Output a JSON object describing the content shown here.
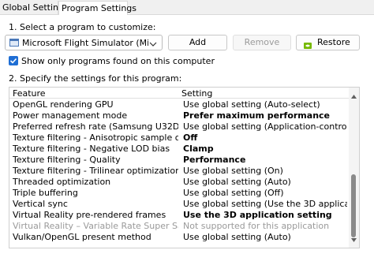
{
  "tabs": [
    {
      "label": "Global Settings"
    },
    {
      "label": "Program Settings"
    }
  ],
  "step1_label": "1. Select a program to customize:",
  "program_select": {
    "value": "Microsoft Flight Simulator (Micros..."
  },
  "buttons": {
    "add": "Add",
    "remove": "Remove",
    "restore": "Restore"
  },
  "show_only_checkbox": {
    "label": "Show only programs found on this computer",
    "checked": true
  },
  "step2_label": "2. Specify the settings for this program:",
  "table": {
    "headers": {
      "feature": "Feature",
      "setting": "Setting"
    },
    "rows": [
      {
        "feature": "OpenGL rendering GPU",
        "setting": "Use global setting (Auto-select)"
      },
      {
        "feature": "Power management mode",
        "setting": "Prefer maximum performance"
      },
      {
        "feature": "Preferred refresh rate (Samsung U32D970)",
        "setting": "Use global setting (Application-controlled)"
      },
      {
        "feature": "Texture filtering - Anisotropic sample opti...",
        "setting": "Off"
      },
      {
        "feature": "Texture filtering - Negative LOD bias",
        "setting": "Clamp"
      },
      {
        "feature": "Texture filtering - Quality",
        "setting": "Performance"
      },
      {
        "feature": "Texture filtering - Trilinear optimization",
        "setting": "Use global setting (On)"
      },
      {
        "feature": "Threaded optimization",
        "setting": "Use global setting (Auto)"
      },
      {
        "feature": "Triple buffering",
        "setting": "Use global setting (Off)"
      },
      {
        "feature": "Vertical sync",
        "setting": "Use global setting (Use the 3D application s..."
      },
      {
        "feature": "Virtual Reality pre-rendered frames",
        "setting": "Use the 3D application setting"
      },
      {
        "feature": "Virtual Reality – Variable Rate Super Sampli...",
        "setting": "Not supported for this application"
      },
      {
        "feature": "Vulkan/OpenGL present method",
        "setting": "Use global setting (Auto)"
      }
    ]
  },
  "colors": {
    "accent": "#1f6ed4",
    "nvidia_green": "#76b900",
    "disabled_text": "#9a9a9a"
  }
}
